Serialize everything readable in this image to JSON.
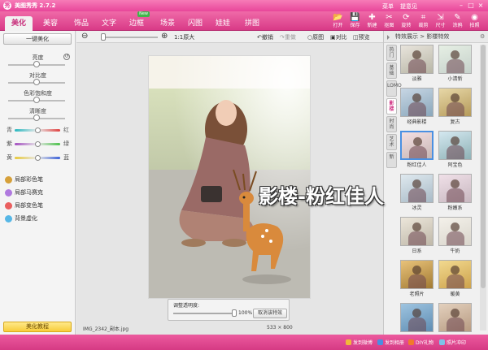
{
  "window": {
    "title": "美图秀秀 2.7.2",
    "menu": [
      "菜单",
      "提意见"
    ],
    "controls": [
      "–",
      "□",
      "×"
    ]
  },
  "tabs": [
    {
      "label": "美化",
      "active": true,
      "new": false
    },
    {
      "label": "美容",
      "active": false,
      "new": false
    },
    {
      "label": "饰品",
      "active": false,
      "new": false
    },
    {
      "label": "文字",
      "active": false,
      "new": false
    },
    {
      "label": "边框",
      "active": false,
      "new": true
    },
    {
      "label": "场景",
      "active": false,
      "new": false
    },
    {
      "label": "闪图",
      "active": false,
      "new": false
    },
    {
      "label": "娃娃",
      "active": false,
      "new": false
    },
    {
      "label": "拼图",
      "active": false,
      "new": false
    }
  ],
  "toolbar_buttons": [
    {
      "label": "打开",
      "icon": "folder-icon"
    },
    {
      "label": "保存",
      "icon": "save-icon"
    },
    {
      "label": "新建",
      "icon": "new-icon"
    },
    {
      "label": "抠图",
      "icon": "cutout-icon"
    },
    {
      "label": "旋转",
      "icon": "rotate-icon"
    },
    {
      "label": "裁剪",
      "icon": "crop-icon"
    },
    {
      "label": "尺寸",
      "icon": "resize-icon"
    },
    {
      "label": "涂鸦",
      "icon": "brush-icon"
    },
    {
      "label": "拍照",
      "icon": "camera-icon"
    }
  ],
  "left_panel": {
    "one_key_label": "一键美化",
    "adjustments": [
      {
        "label": "亮度",
        "level": 0.5
      },
      {
        "label": "对比度",
        "level": 0.5
      },
      {
        "label": "色彩饱和度",
        "level": 0.5
      },
      {
        "label": "清晰度",
        "level": 0.5
      }
    ],
    "color_balance": [
      {
        "left": "青",
        "right": "红",
        "level": 0.5,
        "colors": [
          "#27b8c0",
          "#e0403f"
        ]
      },
      {
        "left": "紫",
        "right": "绿",
        "level": 0.5,
        "colors": [
          "#a34fc0",
          "#4bc14a"
        ]
      },
      {
        "left": "黄",
        "right": "蓝",
        "level": 0.5,
        "colors": [
          "#e8c93a",
          "#3d62d8"
        ]
      }
    ],
    "tools": [
      {
        "label": "局部彩色笔",
        "color": "#d6a03a"
      },
      {
        "label": "局部马赛克",
        "color": "#b07adf"
      },
      {
        "label": "局部变色笔",
        "color": "#ea5f5f"
      },
      {
        "label": "背景虚化",
        "color": "#56b7e6"
      }
    ],
    "tutorial_label": "美化教程"
  },
  "zoom_bar": {
    "zoom_out": "⊖",
    "zoom_in": "⊕",
    "actual_size": "1:1原大",
    "undo": "撤销",
    "redo": "重做",
    "original": "原图",
    "compare": "对比",
    "preview": "预览"
  },
  "canvas": {
    "filename": "IMG_2342_副本.jpg",
    "dimensions": "533 × 800",
    "opacity_label": "调整透明度:",
    "opacity_value": "100%",
    "opacity_level": 1.0,
    "cancel_label": "取消该特效"
  },
  "right_panel": {
    "header": "特效展示 > 影楼特效",
    "side_tabs": [
      {
        "label": "热门",
        "active": false
      },
      {
        "label": "基础",
        "active": false
      },
      {
        "label": "LOMO",
        "active": false
      },
      {
        "label": "影楼",
        "active": true
      },
      {
        "label": "时尚",
        "active": false
      },
      {
        "label": "艺术",
        "active": false
      },
      {
        "label": "新",
        "active": false
      }
    ],
    "thumbnails": [
      {
        "name": "淡雅",
        "colors": [
          "#e8e4dc",
          "#b8b6a6"
        ],
        "selected": false
      },
      {
        "name": "小清新",
        "colors": [
          "#e6efe4",
          "#c6d1cb"
        ],
        "selected": false
      },
      {
        "name": "经典影楼",
        "colors": [
          "#c7d6e4",
          "#8aa7bb"
        ],
        "selected": false
      },
      {
        "name": "复古",
        "colors": [
          "#e7d7a7",
          "#b59a5a"
        ],
        "selected": false
      },
      {
        "name": "粉红佳人",
        "colors": [
          "#f4dfe2",
          "#c7b7b5"
        ],
        "selected": true
      },
      {
        "name": "阿宝色",
        "colors": [
          "#d4e8f0",
          "#8fb2b6"
        ],
        "selected": false
      },
      {
        "name": "冰灵",
        "colors": [
          "#dfe9ef",
          "#a8bac6"
        ],
        "selected": false
      },
      {
        "name": "粉嫩系",
        "colors": [
          "#f0e0e8",
          "#c8b8c0"
        ],
        "selected": false
      },
      {
        "name": "日系",
        "colors": [
          "#ece6da",
          "#bfb8a9"
        ],
        "selected": false
      },
      {
        "name": "牛奶",
        "colors": [
          "#f4f1ea",
          "#d9d5cc"
        ],
        "selected": false
      },
      {
        "name": "老照片",
        "colors": [
          "#e8c27a",
          "#a37b33"
        ],
        "selected": false
      },
      {
        "name": "暖黄",
        "colors": [
          "#f2d98f",
          "#cda24c"
        ],
        "selected": false
      },
      {
        "name": "",
        "colors": [
          "#9ec4e0",
          "#5f8db3"
        ],
        "selected": false
      },
      {
        "name": "",
        "colors": [
          "#e3d0bd",
          "#b79b82"
        ],
        "selected": false
      }
    ]
  },
  "status_bar": [
    {
      "label": "发到微博",
      "color": "#f1b83a"
    },
    {
      "label": "发到相册",
      "color": "#4a8ee2"
    },
    {
      "label": "DIY礼物",
      "color": "#f17a2b"
    },
    {
      "label": "照片冲印",
      "color": "#7ec2e8"
    }
  ],
  "overlay_text": "影楼-粉红佳人",
  "colors": {
    "brand_pink": "#e8469a",
    "accent_blue": "#4a90e2",
    "tutorial_yellow": "#f7cc3a"
  }
}
